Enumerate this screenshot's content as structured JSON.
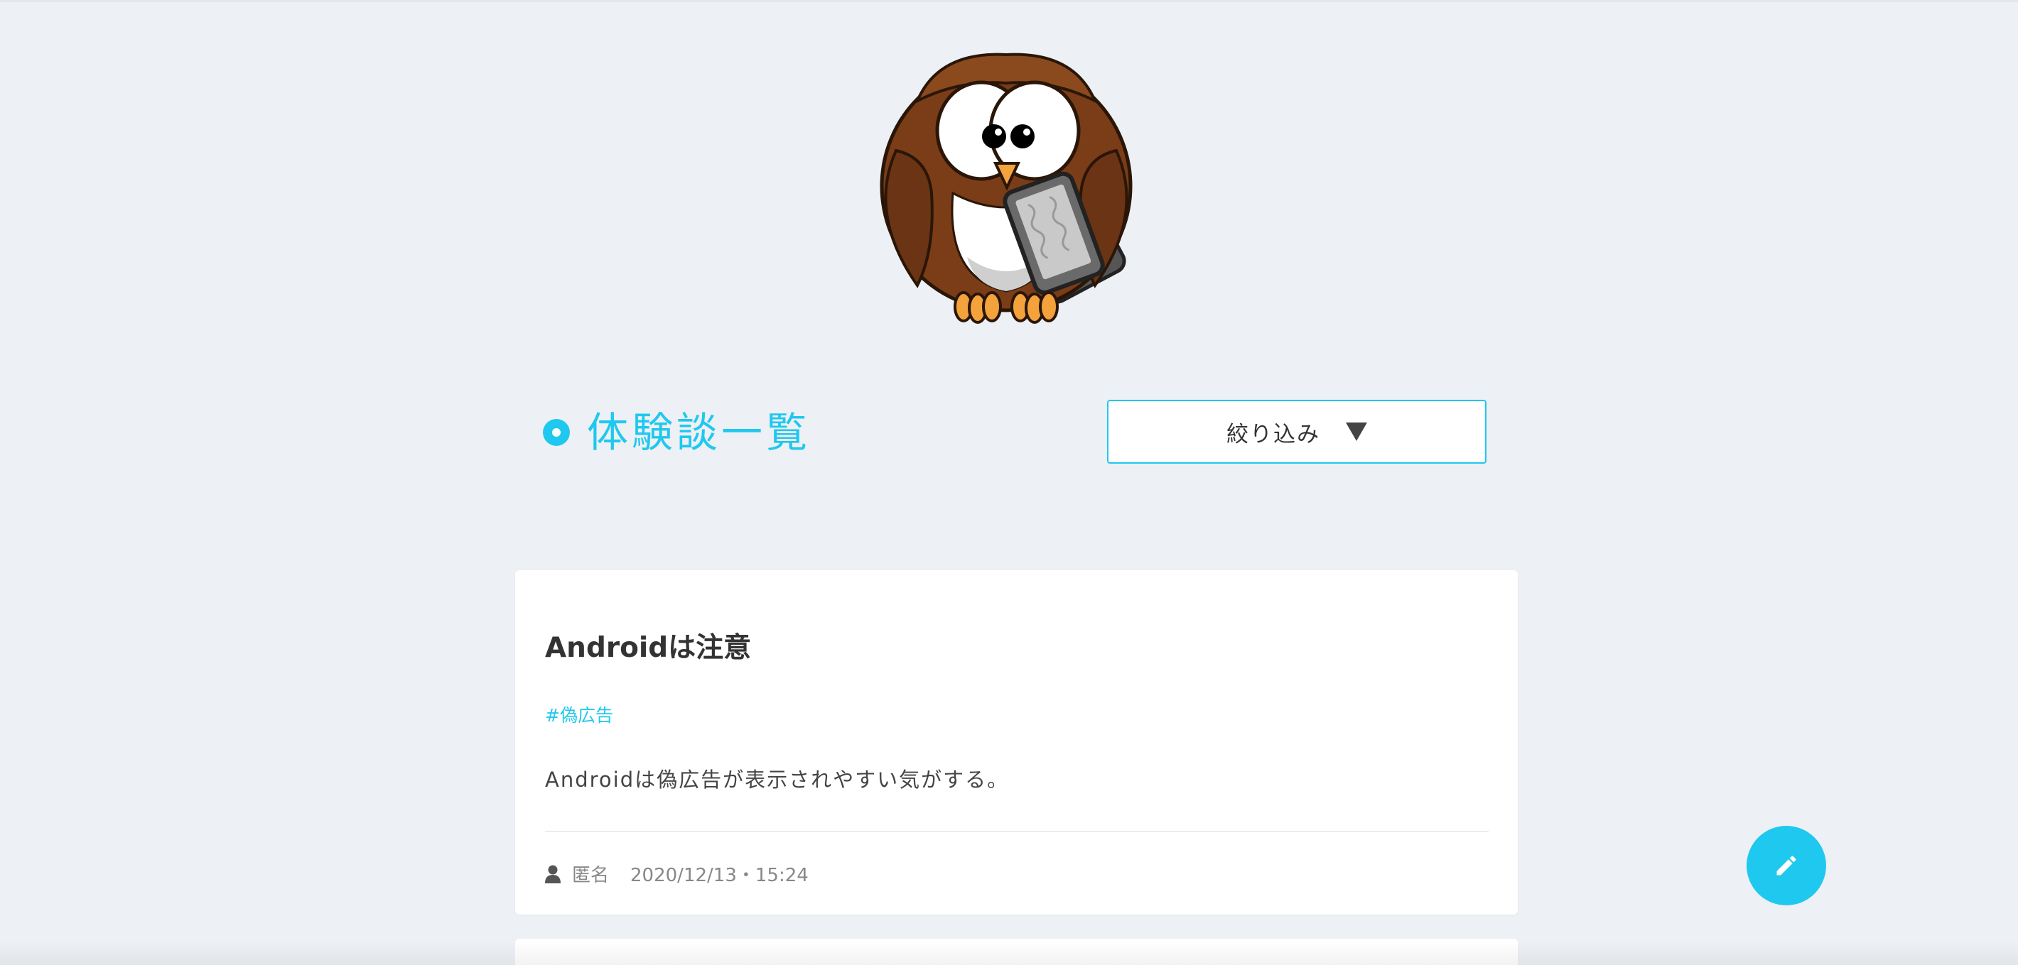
{
  "header": {
    "logo_icon": "owl-with-tablet-icon"
  },
  "section": {
    "title": "体験談一覧"
  },
  "filter": {
    "label": "絞り込み",
    "icon": "caret-down-icon"
  },
  "posts": [
    {
      "title": "Androidは注意",
      "tag": "#偽広告",
      "body": "Androidは偽広告が表示されやすい気がする。",
      "author": "匿名",
      "datetime": "2020/12/13・15:24"
    }
  ],
  "fab": {
    "icon": "pencil-icon"
  },
  "colors": {
    "accent": "#1fc8ee",
    "background": "#edf0f5",
    "card": "#ffffff",
    "text": "#333333",
    "muted": "#888888"
  }
}
